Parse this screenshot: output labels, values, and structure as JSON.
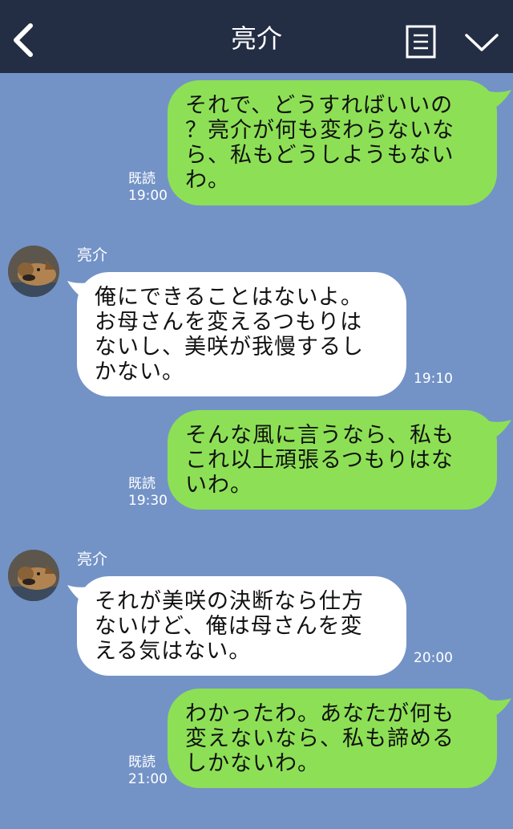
{
  "header": {
    "title": "亮介",
    "back_icon": "chevron-left-icon",
    "menu_icon": "document-menu-icon",
    "more_icon": "chevron-down-icon",
    "bg_color": "#232d44"
  },
  "theme": {
    "chat_bg": "#7393c7",
    "out_bubble": "#8de055",
    "in_bubble": "#ffffff"
  },
  "messages": [
    {
      "direction": "outgoing",
      "lines": [
        "それで、どうすればいいの",
        "？亮介が何も変わらないな",
        "ら、私もどうしようもない",
        "わ。"
      ],
      "read_label": "既読",
      "time": "19:00"
    },
    {
      "direction": "incoming",
      "sender": "亮介",
      "lines": [
        "俺にできることはないよ。",
        "お母さんを変えるつもりは",
        "ないし、美咲が我慢するし",
        "かない。"
      ],
      "time": "19:10"
    },
    {
      "direction": "outgoing",
      "lines": [
        "そんな風に言うなら、私も",
        "これ以上頑張るつもりはな",
        "いわ。"
      ],
      "read_label": "既読",
      "time": "19:30"
    },
    {
      "direction": "incoming",
      "sender": "亮介",
      "lines": [
        "それが美咲の決断なら仕方",
        "ないけど、俺は母さんを変",
        "える気はない。"
      ],
      "time": "20:00"
    },
    {
      "direction": "outgoing",
      "lines": [
        "わかったわ。あなたが何も",
        "変えないなら、私も諦める",
        "しかないわ。"
      ],
      "read_label": "既読",
      "time": "21:00"
    }
  ]
}
